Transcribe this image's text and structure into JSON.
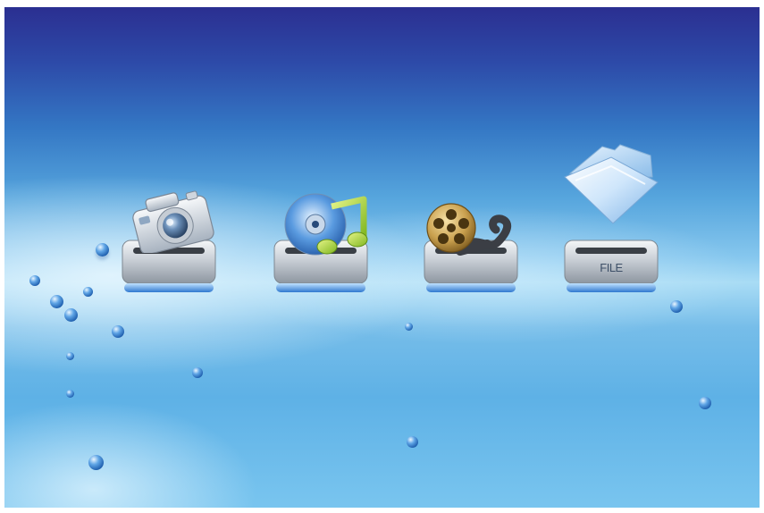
{
  "menu": {
    "items": [
      {
        "id": "photo",
        "icon": "camera-icon"
      },
      {
        "id": "music",
        "icon": "music-disc-icon"
      },
      {
        "id": "movie",
        "icon": "film-reel-icon"
      },
      {
        "id": "file",
        "icon": "folder-icon",
        "label": "FILE"
      }
    ]
  },
  "colors": {
    "background_top": "#2b2f91",
    "background_mid": "#86c7ee",
    "background_bottom": "#79c5ef",
    "bubble": "#1f5fae",
    "pedestal_glow": "#3f86d8"
  }
}
